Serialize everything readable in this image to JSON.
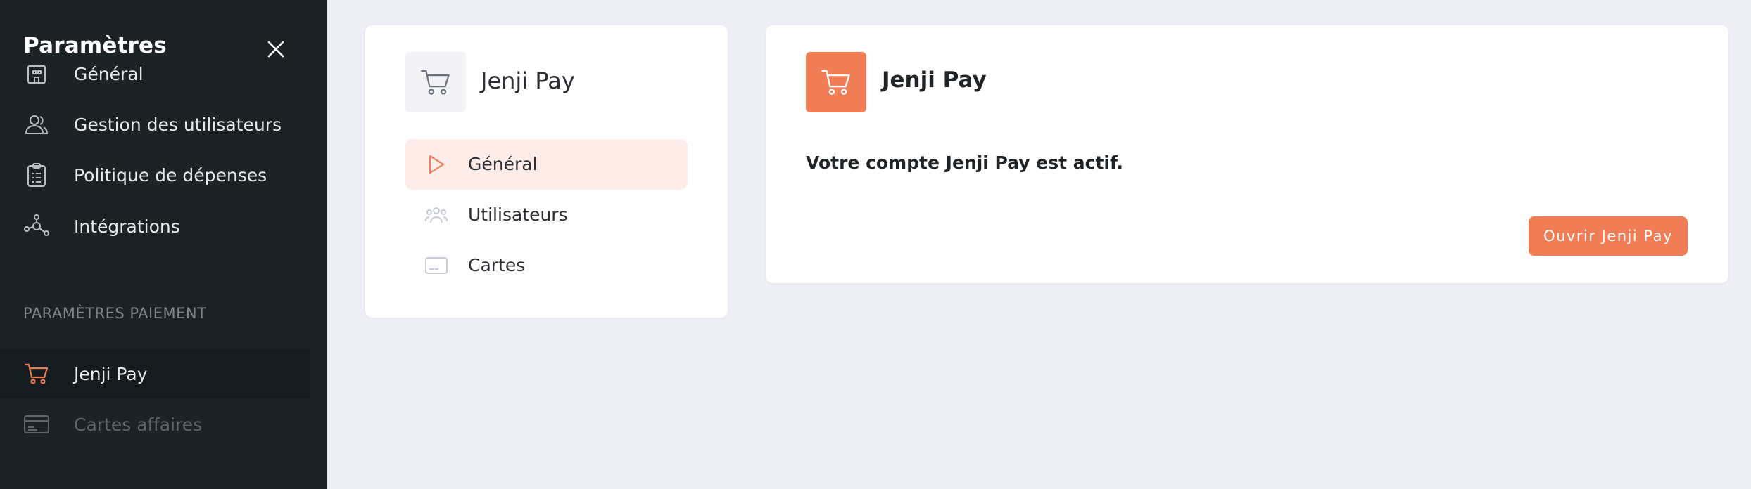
{
  "colors": {
    "accent": "#f07d55",
    "accent_light": "#fdece7",
    "sidebar_bg": "#1b2327",
    "page_bg": "#eeeef6"
  },
  "sidebar": {
    "title": "Paramètres",
    "items": [
      {
        "label": "Général",
        "icon": "building-icon"
      },
      {
        "label": "Gestion des utilisateurs",
        "icon": "users-icon"
      },
      {
        "label": "Politique de dépenses",
        "icon": "clipboard-icon"
      },
      {
        "label": "Intégrations",
        "icon": "integrations-icon"
      }
    ],
    "section_title": "PARAMÈTRES PAIEMENT",
    "payment_items": [
      {
        "label": "Jenji Pay",
        "icon": "cart-icon",
        "active": true
      },
      {
        "label": "Cartes affaires",
        "icon": "credit-card-icon",
        "disabled": true
      }
    ]
  },
  "middle": {
    "title": "Jenji Pay",
    "icon": "cart-icon",
    "nav": [
      {
        "label": "Général",
        "icon": "play-icon",
        "active": true
      },
      {
        "label": "Utilisateurs",
        "icon": "users-icon"
      },
      {
        "label": "Cartes",
        "icon": "card-icon"
      }
    ]
  },
  "main": {
    "title": "Jenji Pay",
    "icon": "cart-icon",
    "status": "Votre compte Jenji Pay est actif.",
    "button_label": "Ouvrir Jenji Pay"
  }
}
